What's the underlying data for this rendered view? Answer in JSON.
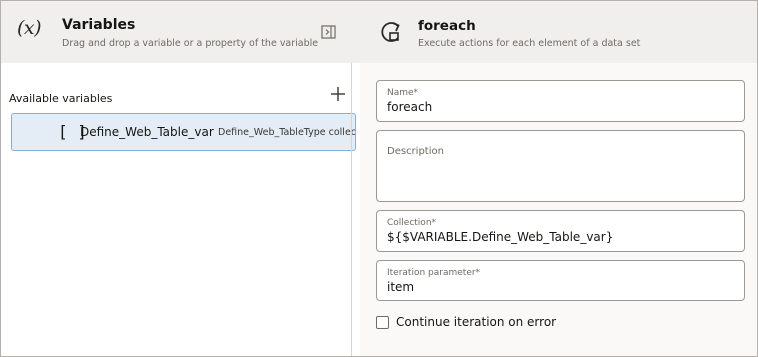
{
  "left_panel": {
    "icon_text": "(x)",
    "title": "Variables",
    "subtitle": "Drag and drop a variable or a property of the variable",
    "available_label": "Available variables",
    "variables": [
      {
        "bracket": "[ ]",
        "name": "Define_Web_Table_var",
        "type": "Define_Web_TableType collec"
      }
    ]
  },
  "right_panel": {
    "title": "foreach",
    "subtitle": "Execute actions for each element of a data set",
    "fields": {
      "name": {
        "label": "Name*",
        "value": "foreach"
      },
      "description": {
        "label": "Description",
        "value": ""
      },
      "collection": {
        "label": "Collection*",
        "value": "${$VARIABLE.Define_Web_Table_var}"
      },
      "iteration": {
        "label": "Iteration parameter*",
        "value": "item"
      }
    },
    "continue_on_error_label": "Continue iteration on error"
  },
  "icons": {
    "collapse": "collapse-panel-icon",
    "add": "plus-icon",
    "loop": "loop-icon"
  },
  "colors": {
    "header_bg": "#f1efed",
    "selected_row_bg": "#e4edf5",
    "selected_row_border": "#8aaecf"
  }
}
